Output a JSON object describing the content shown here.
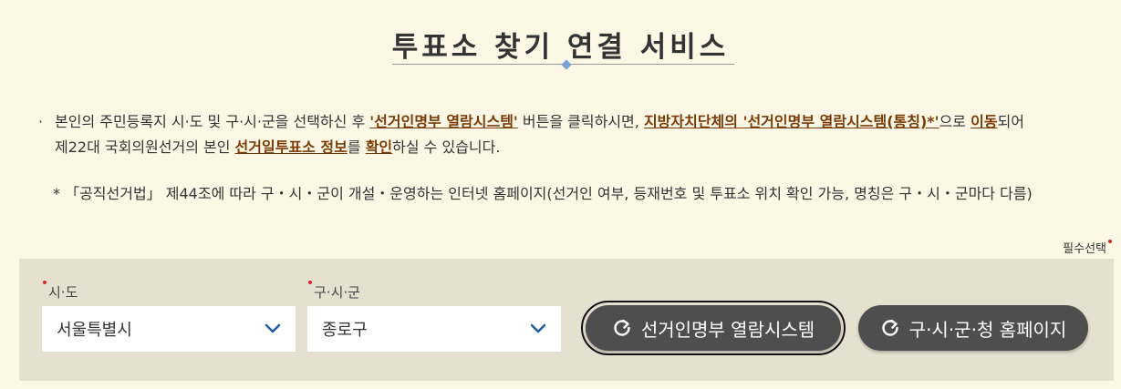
{
  "page": {
    "title": "투표소 찾기 연결 서비스"
  },
  "notice": {
    "bullet": "·",
    "p1": "본인의 주민등록지 시·도 및 구·시·군을 선택하신 후 ",
    "em1": "'선거인명부 열람시스템'",
    "p2": " 버튼을 클릭하시면, ",
    "em2": "지방자치단체의 '선거인명부 열람시스템(통칭)*'",
    "p3": "으로 ",
    "em3": "이동",
    "p4": "되어",
    "p5": "제22대 국회의원선거의 본인 ",
    "em4": "선거일투표소 정보",
    "p6": "를 ",
    "em5": "확인",
    "p7": "하실 수 있습니다.",
    "footnote": "* 「공직선거법」 제44조에 따라 구・시・군이 개설・운영하는 인터넷 홈페이지(선거인 여부, 등재번호 및 투표소 위치 확인 가능, 명칭은 구・시・군마다 다름)"
  },
  "form": {
    "required_hint": "필수선택",
    "sido_label": "시·도",
    "sido_value": "서울특별시",
    "sigungu_label": "구·시·군",
    "sigungu_value": "종로구",
    "btn_registry": "선거인명부 열람시스템",
    "btn_homepage": "구·시·군·청 홈페이지"
  },
  "icons": {
    "chevron": "chevron-down-icon",
    "refresh": "refresh-icon"
  },
  "colors": {
    "background": "#fdf8e6",
    "panel": "#e6e0d0",
    "emphasis": "#7a3b07",
    "button": "#4e4e4e",
    "chevron": "#1f5fa8",
    "required_dot": "#d62b2b"
  }
}
